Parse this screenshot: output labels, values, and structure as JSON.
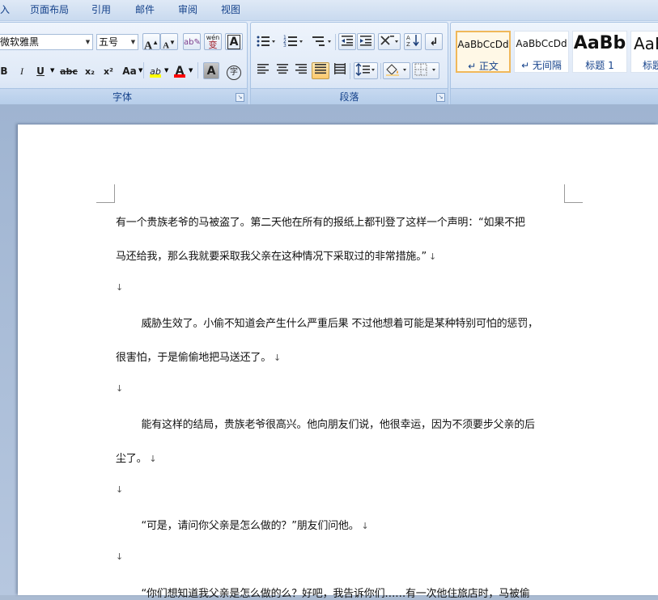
{
  "menu": {
    "tabs": [
      "入",
      "页面布局",
      "引用",
      "邮件",
      "审阅",
      "视图"
    ]
  },
  "font_group": {
    "label": "字体",
    "font_name": "微软雅黑",
    "font_size": "五号",
    "grow_label": "A",
    "shrink_label": "A",
    "wen_label": "wén",
    "wen_char": "变",
    "border_a": "A",
    "bold": "B",
    "italic": "I",
    "underline": "U",
    "strike": "abc",
    "subscript": "x₂",
    "superscript": "x²",
    "case": "Aa",
    "highlight": "ab",
    "font_color": "A",
    "shade_a": "A",
    "circle_char": "字"
  },
  "para_group": {
    "label": "段落"
  },
  "styles": [
    {
      "sample": "AaBbCcDd",
      "name": "↵ 正文"
    },
    {
      "sample": "AaBbCcDd",
      "name": "↵ 无间隔"
    },
    {
      "sample": "AaBb",
      "name": "标题 1"
    },
    {
      "sample": "AaB",
      "name": "标题"
    }
  ],
  "document": {
    "lines": [
      "有一个贵族老爷的马被盗了。第二天他在所有的报纸上都刊登了这样一个声明：“如果不把",
      "马还给我，那么我就要采取我父亲在这种情况下采取过的非常措施。”",
      "",
      "        威胁生效了。小偷不知道会产生什么严重后果 不过他想着可能是某种特别可怕的惩罚，",
      "很害怕，于是偷偷地把马送还了。",
      "",
      "        能有这样的结局，贵族老爷很高兴。他向朋友们说，他很幸运，因为不须要步父亲的后",
      "尘了。",
      "",
      "        “可是，请问你父亲是怎么做的？”朋友们问他。",
      "",
      "        “你们想知道我父亲是怎么做的么？好吧，我告诉你们……有一次他住旅店时，马被偷"
    ],
    "para_mark": "↓"
  },
  "colors": {
    "accent": "#15428b",
    "highlight": "#ffff00",
    "font_color": "#ff0000"
  }
}
